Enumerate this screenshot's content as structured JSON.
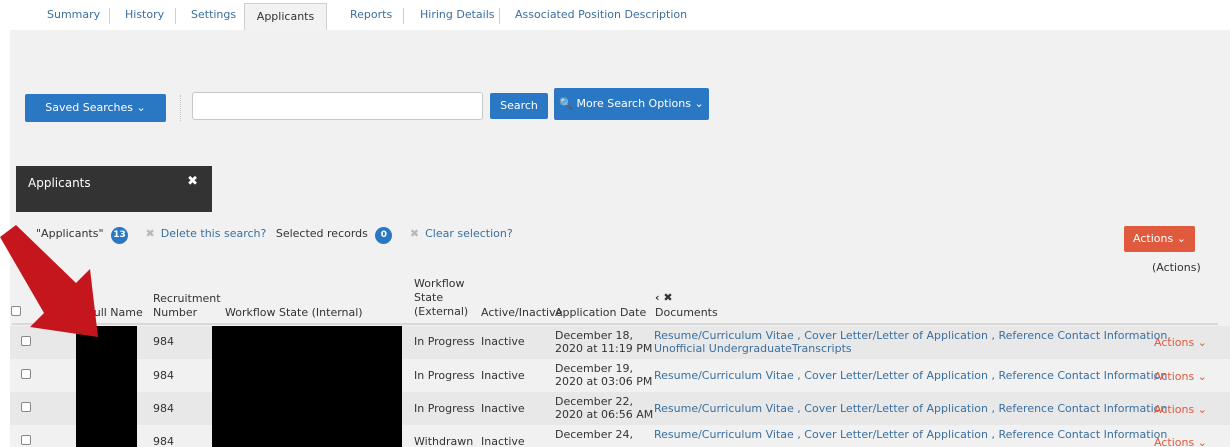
{
  "tabs": {
    "summary": "Summary",
    "history": "History",
    "settings": "Settings",
    "applicants": "Applicants",
    "reports": "Reports",
    "hiring_details": "Hiring Details",
    "associated_position": "Associated Position Description"
  },
  "toolbar": {
    "saved_searches": "Saved Searches ⌄",
    "search_value": "",
    "search_label": "Search",
    "more_options": "🔍 More Search Options ⌄"
  },
  "applicants_tab": {
    "label": "Applicants",
    "close": "✖"
  },
  "info": {
    "saved_name": "\"Applicants\"",
    "applicant_count": "13",
    "delete_search": "Delete this search?",
    "selected_label": "Selected records",
    "selected_count": "0",
    "clear_selection": "Clear selection?"
  },
  "actions_button": "Actions ⌄",
  "actions_header": "(Actions)",
  "columns": {
    "full_name": "Full Name",
    "recruitment_number": "Recruitment Number",
    "workflow_internal": "Workflow State (Internal)",
    "workflow_external": "Workflow State (External)",
    "active_inactive": "Active/Inactive",
    "application_date": "Application Date",
    "documents_controls": "‹ ✖",
    "documents": "Documents"
  },
  "rows": [
    {
      "recruitment_number": "984",
      "workflow_external": "In Progress",
      "active": "Inactive",
      "date_line1": "December 18,",
      "date_line2": "2020 at 11:19 PM",
      "docs_line1": "Resume/Curriculum Vitae , Cover Letter/Letter of Application , Reference Contact Information,",
      "docs_line2": "Unofficial UndergraduateTranscripts",
      "action": "Actions ⌄"
    },
    {
      "recruitment_number": "984",
      "workflow_external": "In Progress",
      "active": "Inactive",
      "date_line1": "December 19,",
      "date_line2": "2020 at 03:06 PM",
      "docs_line1": "Resume/Curriculum Vitae , Cover Letter/Letter of Application , Reference Contact Information",
      "docs_line2": "",
      "action": "Actions ⌄"
    },
    {
      "recruitment_number": "984",
      "workflow_external": "In Progress",
      "active": "Inactive",
      "date_line1": "December 22,",
      "date_line2": "2020 at 06:56 AM",
      "docs_line1": "Resume/Curriculum Vitae , Cover Letter/Letter of Application , Reference Contact Information",
      "docs_line2": "",
      "action": "Actions ⌄"
    },
    {
      "recruitment_number": "984",
      "workflow_external": "Withdrawn",
      "active": "Inactive",
      "date_line1": "December 24,",
      "date_line2": "",
      "docs_line1": "Resume/Curriculum Vitae , Cover Letter/Letter of Application , Reference Contact Information",
      "docs_line2": "",
      "action": "Actions ⌄"
    }
  ],
  "colors": {
    "primary": "#2a78c4",
    "danger": "#e05a3e",
    "link": "#3a6fa0",
    "dark_tab": "#333333",
    "arrow": "#c4161c"
  }
}
